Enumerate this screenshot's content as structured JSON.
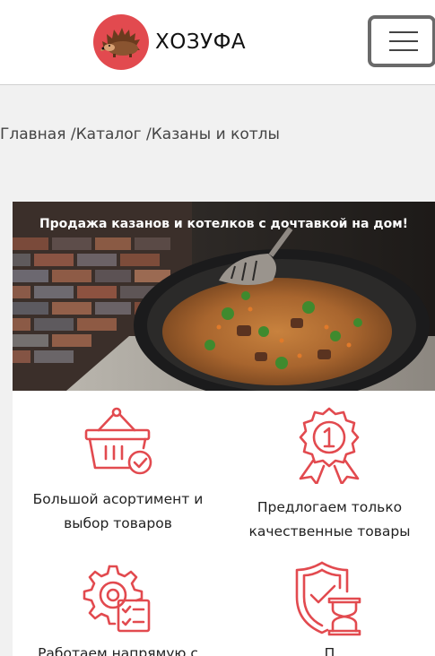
{
  "header": {
    "logo_text": "ХОЗУФА",
    "menu_icon": "hamburger-icon"
  },
  "breadcrumb": {
    "home": "Главная",
    "catalog": "Каталог",
    "current": "Казаны и котлы",
    "separator": " /"
  },
  "banner": {
    "title": "Продажа казанов и котелков с дочтавкой на дом!"
  },
  "features": [
    {
      "line1": "Большой асортимент и",
      "line2": "выбор товаров",
      "icon": "basket-check-icon"
    },
    {
      "line1": "Предлогаем только",
      "line2": "качественные товары",
      "icon": "award-badge-icon"
    },
    {
      "line1": "Работаем напрямую с",
      "line2": "",
      "icon": "gear-checklist-icon"
    },
    {
      "line1": "П",
      "line2": "",
      "icon": "shield-hourglass-icon"
    }
  ],
  "colors": {
    "accent": "#e24a4f",
    "page_bg": "#f1f1f1"
  }
}
